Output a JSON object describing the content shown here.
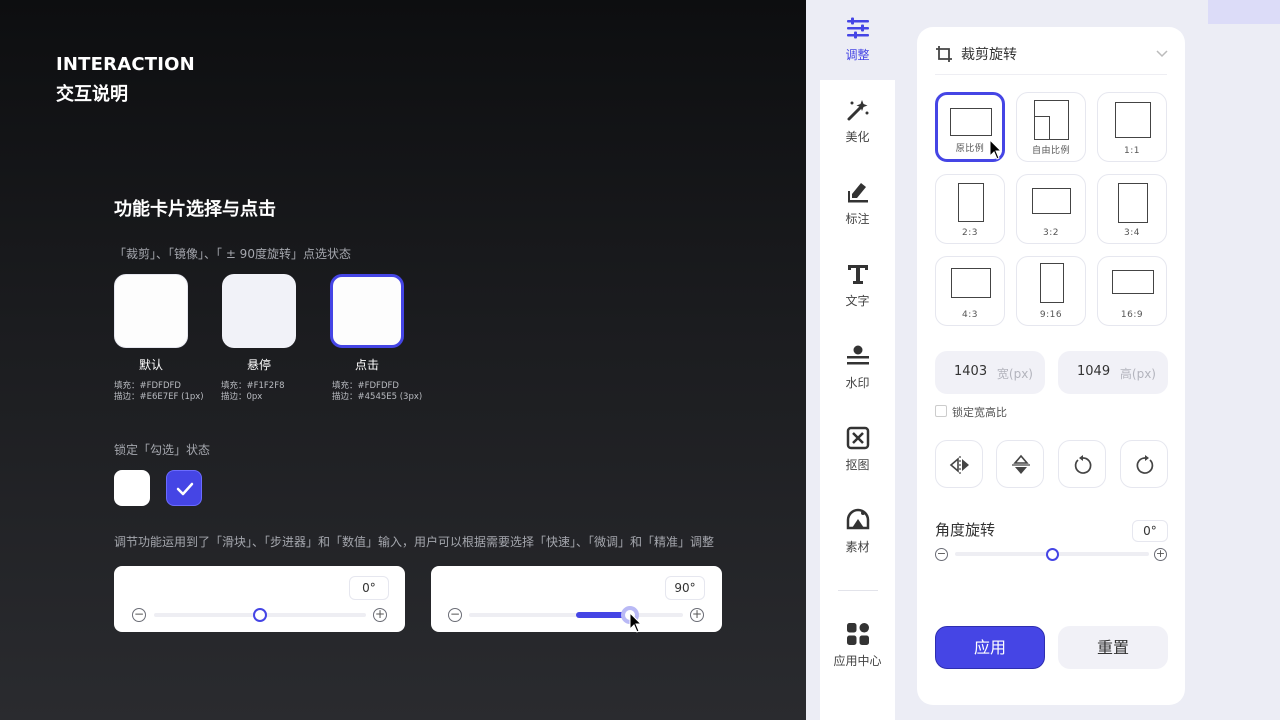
{
  "guide": {
    "header_en": "INTERACTION",
    "header_cn": "交互说明",
    "section_title": "功能卡片选择与点击",
    "card_states_caption": "「裁剪」、「镜像」、「 ± 90度旋转」点选状态",
    "states": [
      {
        "label": "默认",
        "meta1": "填充：#FDFDFD",
        "meta2": "描边：#E6E7EF (1px)",
        "fill": "#FDFDFD",
        "stroke": "#E6E7EF"
      },
      {
        "label": "悬停",
        "meta1": "填充：#F1F2F8",
        "meta2": "描边：0px",
        "fill": "#F1F2F8"
      },
      {
        "label": "点击",
        "meta1": "填充：#FDFDFD",
        "meta2": "描边：#4545E5 (3px)",
        "fill": "#FDFDFD",
        "stroke": "#4545E5"
      }
    ],
    "checkbox_caption": "锁定「勾选」状态",
    "slider_caption": "调节功能运用到了「滑块」、「步进器」和「数值」输入，用户可以根据需要选择「快速」、「微调」和「精准」调整",
    "slider_examples": [
      {
        "value": "0°",
        "level": 0.5
      },
      {
        "value": "90°",
        "level": 0.75
      }
    ]
  },
  "app": {
    "sidebar": [
      {
        "label": "调整",
        "icon": "sliders-icon",
        "active": true
      },
      {
        "label": "美化",
        "icon": "magic-wand-icon"
      },
      {
        "label": "标注",
        "icon": "marker-icon"
      },
      {
        "label": "文字",
        "icon": "text-icon"
      },
      {
        "label": "水印",
        "icon": "watermark-icon"
      },
      {
        "label": "抠图",
        "icon": "cutout-icon"
      },
      {
        "label": "素材",
        "icon": "material-icon"
      },
      {
        "label": "应用中心",
        "icon": "app-center-icon"
      }
    ],
    "panel": {
      "title": "裁剪旋转",
      "ratios": [
        "原比例",
        "自由比例",
        "1:1",
        "2:3",
        "3:2",
        "3:4",
        "4:3",
        "9:16",
        "16:9"
      ],
      "width_value": "1403",
      "width_unit": "宽(px)",
      "height_value": "1049",
      "height_unit": "高(px)",
      "lock_label": "锁定宽高比",
      "angle_title": "角度旋转",
      "angle_value": "0°",
      "angle_level": 0.5,
      "apply_label": "应用",
      "reset_label": "重置"
    },
    "accent": "#4545E5"
  }
}
